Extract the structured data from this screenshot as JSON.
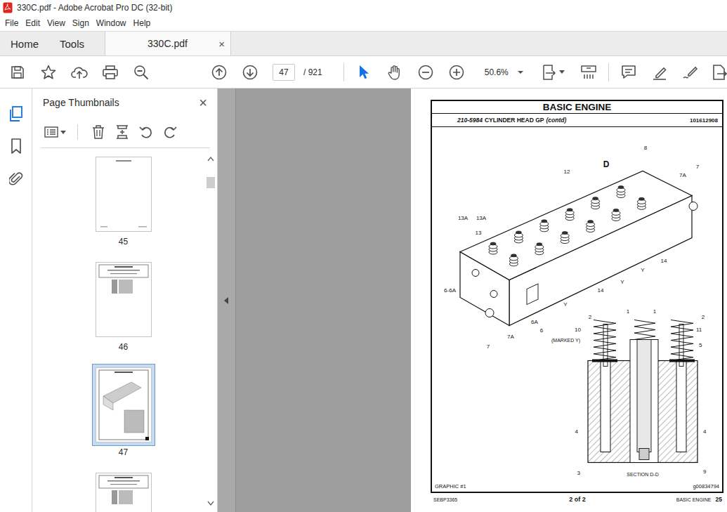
{
  "window": {
    "title": "330C.pdf - Adobe Acrobat Pro DC (32-bit)"
  },
  "menu": [
    "File",
    "Edit",
    "View",
    "Sign",
    "Window",
    "Help"
  ],
  "tabs": [
    {
      "label": "Home",
      "selected": false
    },
    {
      "label": "Tools",
      "selected": false
    },
    {
      "label": "330C.pdf",
      "selected": true,
      "close": "×"
    }
  ],
  "toolbar": {
    "page": "47",
    "total": "/ 921",
    "zoom": "50.6%"
  },
  "sidebar": {
    "title": "Page Thumbnails",
    "close": "×"
  },
  "thumbnails": [
    {
      "label": "45",
      "selected": false,
      "kind": "blank"
    },
    {
      "label": "46",
      "selected": false,
      "kind": "list"
    },
    {
      "label": "47",
      "selected": true,
      "kind": "drawing"
    },
    {
      "label": null,
      "selected": false,
      "kind": "list"
    }
  ],
  "document": {
    "header": "BASIC ENGINE",
    "part": "210-5984",
    "title": "CYLINDER HEAD GP",
    "contd": "(contd)",
    "ref": "101612908",
    "callouts": [
      "8",
      "12",
      "D",
      "7",
      "7A",
      "13A",
      "13A",
      "13",
      "14",
      "Y",
      "Y",
      "14",
      "Y",
      "6-6A",
      "6A",
      "6",
      "7A",
      "(MARKED Y)",
      "7",
      "1",
      "1",
      "2",
      "2",
      "10",
      "11",
      "5",
      "4",
      "4",
      "3",
      "9",
      "SECTION D-D"
    ],
    "graphic": "GRAPHIC #1",
    "graphic_id": "g00834794",
    "footer": {
      "code": "SEBP3365",
      "sheet": "2 of 2",
      "section": "BASIC ENGINE",
      "page": "25"
    }
  }
}
